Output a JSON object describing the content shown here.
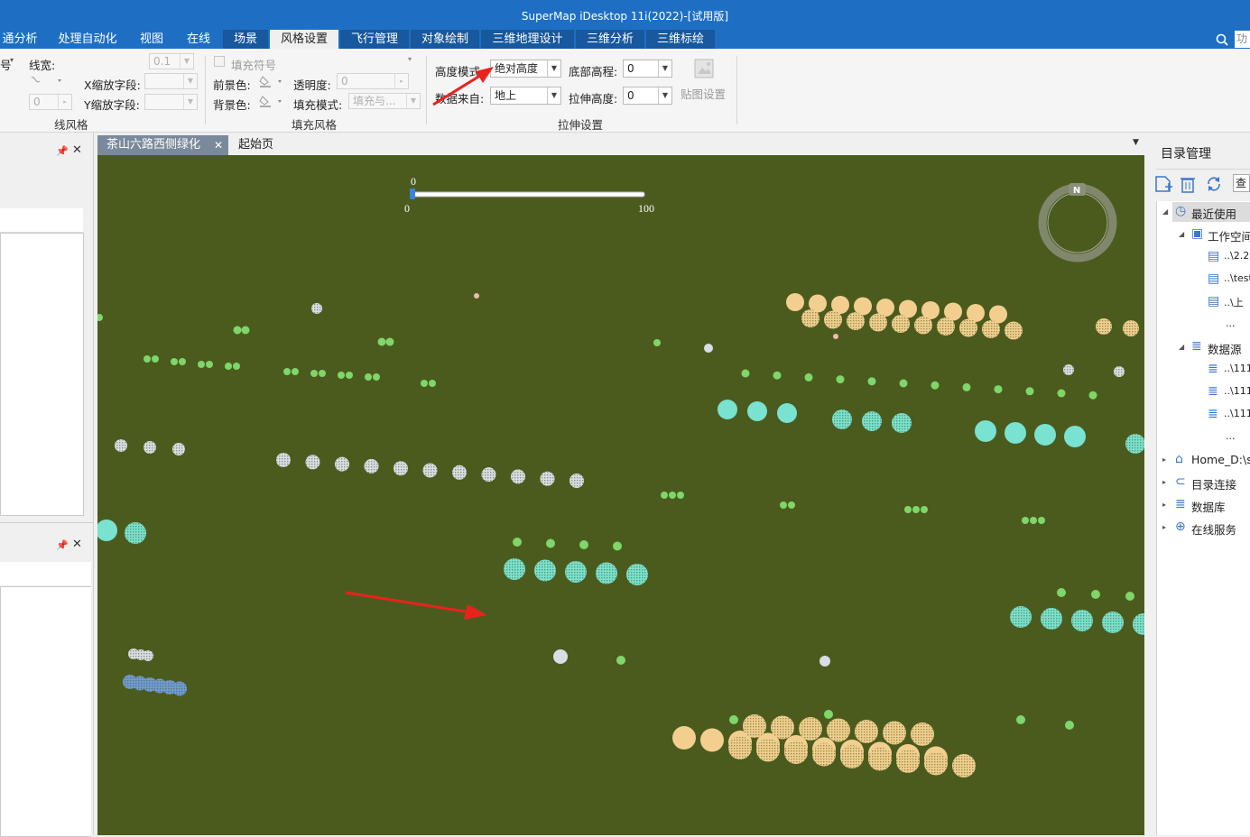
{
  "window": {
    "title": "SuperMap iDesktop 11i(2022)-[试用版]"
  },
  "menu": {
    "tabs": [
      "通分析",
      "处理自动化",
      "视图",
      "在线",
      "场景",
      "风格设置",
      "飞行管理",
      "对象绘制",
      "三维地理设计",
      "三维分析",
      "三维标绘"
    ],
    "active": "风格设置",
    "search_text": "功"
  },
  "ribbon": {
    "line_style": {
      "symbol_label": "号",
      "line_width_label": "线宽:",
      "line_width_value": "0.1",
      "x_scale_label": "X缩放字段:",
      "y_scale_label": "Y缩放字段:",
      "spin_value": "0",
      "group_label": "线风格"
    },
    "fill_style": {
      "fill_symbol_label": "填充符号",
      "fore_color_label": "前景色:",
      "back_color_label": "背景色:",
      "transparency_label": "透明度:",
      "transparency_value": "0",
      "fill_mode_label": "填充模式:",
      "fill_mode_value": "填充与...",
      "group_label": "填充风格"
    },
    "extrude": {
      "height_mode_label": "高度模式:",
      "height_mode_value": "绝对高度",
      "data_source_label": "数据来自:",
      "data_source_value": "地上",
      "bottom_elev_label": "底部高程:",
      "bottom_elev_value": "0",
      "extrude_height_label": "拉伸高度:",
      "extrude_height_value": "0",
      "texture_label": "贴图设置",
      "group_label": "拉伸设置"
    }
  },
  "doc_tabs": [
    {
      "label": "茶山六路西侧绿化",
      "active": true
    },
    {
      "label": "起始页",
      "active": false
    }
  ],
  "map": {
    "slider_value": "0",
    "slider_min": "0",
    "slider_max": "100",
    "compass_label": "N"
  },
  "catalog": {
    "title": "目录管理",
    "search_text": "查",
    "tree": [
      {
        "label": "最近使用",
        "level": 0,
        "icon": "clock-icon"
      },
      {
        "label": "工作空间",
        "level": 1,
        "icon": "workspace-icon"
      },
      {
        "label": "..\\2.2",
        "level": 2,
        "icon": "file-icon"
      },
      {
        "label": "..\\test",
        "level": 2,
        "icon": "file-icon"
      },
      {
        "label": "..\\上",
        "level": 2,
        "icon": "file-icon"
      },
      {
        "label": "...",
        "level": 2,
        "icon": ""
      },
      {
        "label": "数据源",
        "level": 1,
        "icon": "database-icon"
      },
      {
        "label": "..\\111",
        "level": 2,
        "icon": "database-icon"
      },
      {
        "label": "..\\111",
        "level": 2,
        "icon": "database-icon"
      },
      {
        "label": "..\\111",
        "level": 2,
        "icon": "database-icon"
      },
      {
        "label": "...",
        "level": 2,
        "icon": ""
      },
      {
        "label": "Home_D:\\su",
        "level": 0,
        "icon": "home-icon"
      },
      {
        "label": "目录连接",
        "level": 0,
        "icon": "link-icon"
      },
      {
        "label": "数据库",
        "level": 0,
        "icon": "database-icon"
      },
      {
        "label": "在线服务",
        "level": 0,
        "icon": "globe-icon"
      }
    ]
  },
  "colors": {
    "title_bar": "#1e6fc4",
    "map_background": "#4b5b1e",
    "tree_peach": "#f2cf8e",
    "tree_cyan": "#79e2d0",
    "tree_green": "#7fd66a",
    "tree_white": "#d9dde6",
    "tree_blue": "#6f9ad8",
    "annotation_arrow": "#e8231c"
  }
}
